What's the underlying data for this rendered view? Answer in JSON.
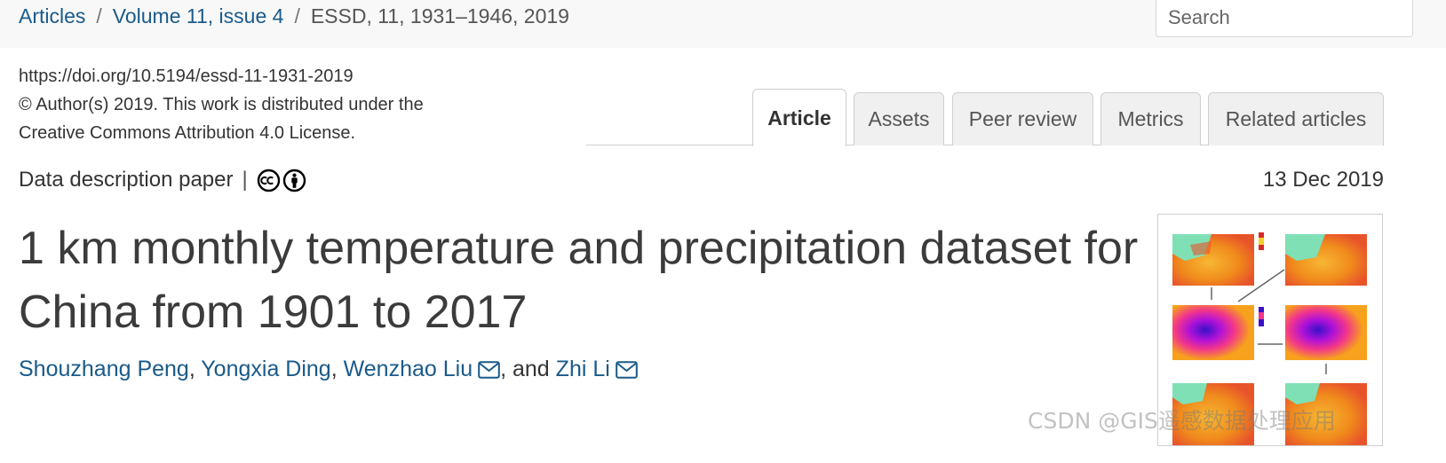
{
  "breadcrumb": {
    "items": [
      "Articles",
      "Volume 11, issue 4"
    ],
    "current": "ESSD, 11, 1931–1946, 2019",
    "separator": "/"
  },
  "search": {
    "placeholder": "Search"
  },
  "article": {
    "doi": "https://doi.org/10.5194/essd-11-1931-2019",
    "license": "© Author(s) 2019. This work is distributed under the Creative Commons Attribution 4.0 License.",
    "paper_type": "Data description paper",
    "type_separator": "|",
    "date": "13 Dec 2019",
    "title": "1 km monthly temperature and precipitation dataset for China from 1901 to 2017",
    "authors": {
      "a1": "Shouzhang Peng",
      "s1": ", ",
      "a2": "Yongxia Ding",
      "s2": ", ",
      "a3": "Wenzhao Liu",
      "s3": ", and ",
      "a4": "Zhi Li"
    }
  },
  "tabs": [
    "Article",
    "Assets",
    "Peer review",
    "Metrics",
    "Related articles"
  ],
  "active_tab": "Article",
  "icons": {
    "license": [
      "creative-commons-icon",
      "attribution-icon"
    ],
    "contact": "mail-icon"
  },
  "colors": {
    "link": "#1a5a8a",
    "text": "#333333",
    "topbar": "#f8f8f8"
  },
  "watermark": "CSDN @GIS遥感数据处理应用"
}
